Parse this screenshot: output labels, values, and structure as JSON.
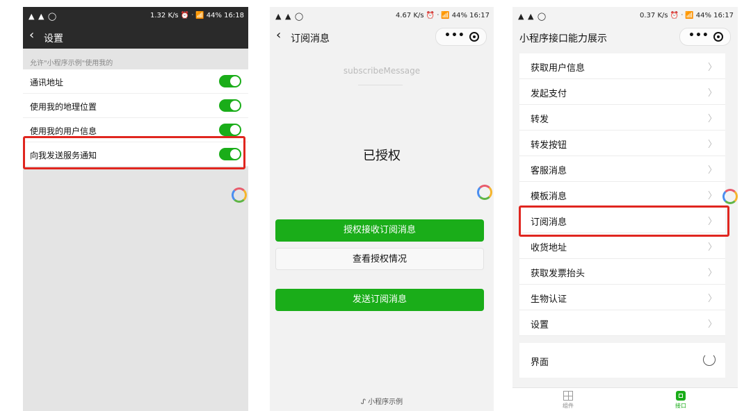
{
  "panel1": {
    "status": {
      "left": "▲ ▲ ◯",
      "right": "1.32 K/s ⏰ ᐧ 📶 44% 16:18"
    },
    "back_icon": "‹",
    "title": "设置",
    "hint": "允许\"小程序示例\"使用我的",
    "items": [
      {
        "label": "通讯地址",
        "on": true
      },
      {
        "label": "使用我的地理位置",
        "on": true
      },
      {
        "label": "使用我的用户信息",
        "on": true
      },
      {
        "label": "向我发送服务通知",
        "on": true
      }
    ]
  },
  "panel2": {
    "status": {
      "left": "▲ ▲ ◯",
      "right": "4.67 K/s ⏰ ᐧ 📶 44% 16:17"
    },
    "back_icon": "‹",
    "title": "订阅消息",
    "capsule_dots": "•••",
    "subtitle": "subscribeMessage",
    "granted": "已授权",
    "buttons": {
      "authorize": "授权接收订阅消息",
      "check": "查看授权情况",
      "send": "发送订阅消息"
    },
    "footer": "小程序示例",
    "footer_icon": "ᔑ"
  },
  "panel3": {
    "status": {
      "left": "▲ ▲ ◯",
      "right": "0.37 K/s ⏰ ᐧ 📶 44% 16:17"
    },
    "title": "小程序接口能力展示",
    "capsule_dots": "•••",
    "chevron": "〉",
    "items": [
      "获取用户信息",
      "发起支付",
      "转发",
      "转发按钮",
      "客服消息",
      "模板消息",
      "订阅消息",
      "收货地址",
      "获取发票抬头",
      "生物认证",
      "设置"
    ],
    "card_label": "界面",
    "tabs": [
      {
        "label": "组件",
        "active": false
      },
      {
        "label": "接口",
        "active": true
      }
    ]
  },
  "colors": {
    "accent": "#1aad19",
    "highlight": "#e0261f"
  }
}
